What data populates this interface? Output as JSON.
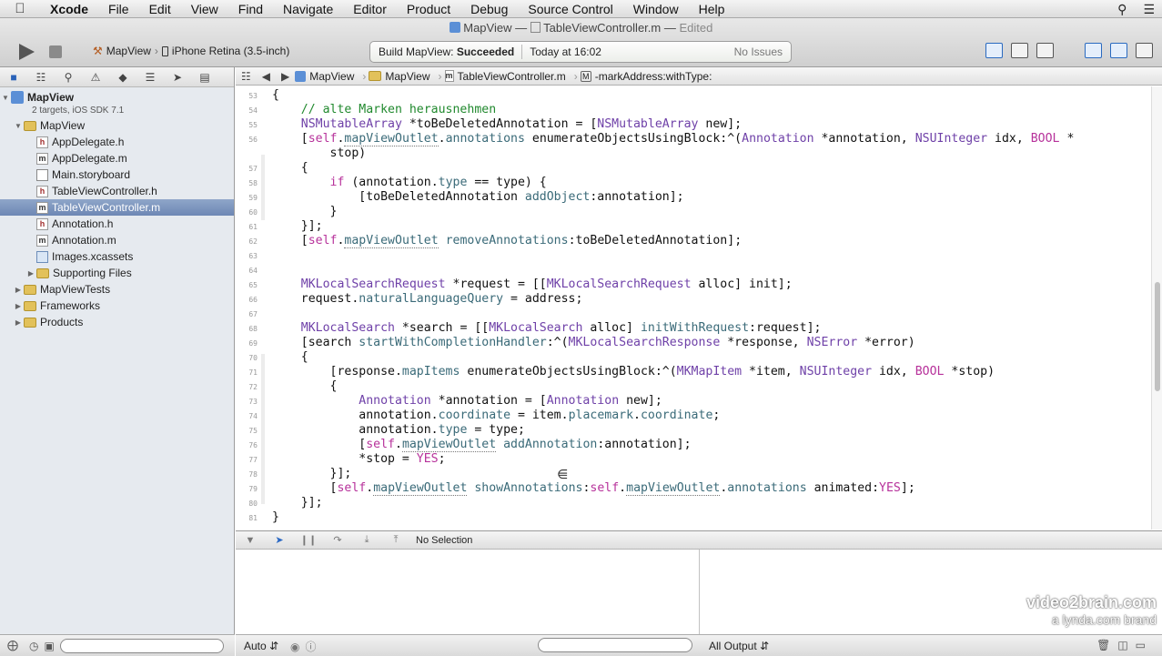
{
  "menubar": {
    "items": [
      "Xcode",
      "File",
      "Edit",
      "View",
      "Find",
      "Navigate",
      "Editor",
      "Product",
      "Debug",
      "Source Control",
      "Window",
      "Help"
    ]
  },
  "window": {
    "project": "MapView",
    "separator": "—",
    "file": "TableViewController.m",
    "edited": "Edited"
  },
  "toolbar": {
    "scheme": "MapView",
    "destination": "iPhone Retina (3.5-inch)",
    "status_prefix": "Build MapView:",
    "status_result": "Succeeded",
    "status_time": "Today at 16:02",
    "issues": "No Issues"
  },
  "navigator": {
    "project_name": "MapView",
    "project_sub": "2 targets, iOS SDK 7.1",
    "items": [
      {
        "label": "MapView",
        "type": "folder",
        "indent": 1,
        "disclosure": "open"
      },
      {
        "label": "AppDelegate.h",
        "type": "h",
        "indent": 2
      },
      {
        "label": "AppDelegate.m",
        "type": "m",
        "indent": 2
      },
      {
        "label": "Main.storyboard",
        "type": "sb",
        "indent": 2
      },
      {
        "label": "TableViewController.h",
        "type": "h",
        "indent": 2
      },
      {
        "label": "TableViewController.m",
        "type": "m",
        "indent": 2,
        "selected": true
      },
      {
        "label": "Annotation.h",
        "type": "h",
        "indent": 2
      },
      {
        "label": "Annotation.m",
        "type": "m",
        "indent": 2
      },
      {
        "label": "Images.xcassets",
        "type": "assets",
        "indent": 2
      },
      {
        "label": "Supporting Files",
        "type": "folder",
        "indent": 2,
        "disclosure": "closed"
      },
      {
        "label": "MapViewTests",
        "type": "folder",
        "indent": 1,
        "disclosure": "closed"
      },
      {
        "label": "Frameworks",
        "type": "folder",
        "indent": 1,
        "disclosure": "closed"
      },
      {
        "label": "Products",
        "type": "folder",
        "indent": 1,
        "disclosure": "closed"
      }
    ]
  },
  "jumpbar": {
    "crumbs": [
      "MapView",
      "MapView",
      "TableViewController.m",
      "-markAddress:withType:"
    ]
  },
  "editor": {
    "lines": [
      {
        "n": "53",
        "html": "{"
      },
      {
        "n": "54",
        "html": "    <span class='cm'>// alte Marken herausnehmen</span>"
      },
      {
        "n": "55",
        "html": "    <span class='ty'>NSMutableArray</span> *toBeDeletedAnnotation = [<span class='ty'>NSMutableArray</span> new];"
      },
      {
        "n": "56",
        "html": "    [<span class='kw'>self</span>.<span class='ul'>mapViewOutlet</span>.<span class='mt'>annotations</span> enumerateObjectsUsingBlock:^(<span class='ty'>Annotation</span> *annotation, <span class='ty'>NSUInteger</span> idx, <span class='kw'>BOOL</span> *"
      },
      {
        "n": "",
        "html": "        stop)"
      },
      {
        "n": "57",
        "html": "    {"
      },
      {
        "n": "58",
        "html": "        <span class='kw'>if</span> (annotation.<span class='mt'>type</span> == type) {"
      },
      {
        "n": "59",
        "html": "            [toBeDeletedAnnotation <span class='mt'>addObject</span>:annotation];"
      },
      {
        "n": "60",
        "html": "        }"
      },
      {
        "n": "61",
        "html": "    }];"
      },
      {
        "n": "62",
        "html": "    [<span class='kw'>self</span>.<span class='ul'>mapViewOutlet</span> <span class='mt'>removeAnnotations</span>:toBeDeletedAnnotation];"
      },
      {
        "n": "63",
        "html": ""
      },
      {
        "n": "64",
        "html": ""
      },
      {
        "n": "65",
        "html": "    <span class='ty'>MKLocalSearchRequest</span> *request = [[<span class='ty'>MKLocalSearchRequest</span> alloc] init];"
      },
      {
        "n": "66",
        "html": "    request.<span class='mt'>naturalLanguageQuery</span> = address;"
      },
      {
        "n": "67",
        "html": ""
      },
      {
        "n": "68",
        "html": "    <span class='ty'>MKLocalSearch</span> *search = [[<span class='ty'>MKLocalSearch</span> alloc] <span class='mt'>initWithRequest</span>:request];"
      },
      {
        "n": "69",
        "html": "    [search <span class='mt'>startWithCompletionHandler</span>:^(<span class='ty'>MKLocalSearchResponse</span> *response, <span class='ty'>NSError</span> *error)"
      },
      {
        "n": "70",
        "html": "    {"
      },
      {
        "n": "71",
        "html": "        [response.<span class='mt'>mapItems</span> enumerateObjectsUsingBlock:^(<span class='ty'>MKMapItem</span> *item, <span class='ty'>NSUInteger</span> idx, <span class='kw'>BOOL</span> *stop)"
      },
      {
        "n": "72",
        "html": "        {"
      },
      {
        "n": "73",
        "html": "            <span class='ty'>Annotation</span> *annotation = [<span class='ty'>Annotation</span> new];"
      },
      {
        "n": "74",
        "html": "            annotation.<span class='mt'>coordinate</span> = item.<span class='mt'>placemark</span>.<span class='mt'>coordinate</span>;"
      },
      {
        "n": "75",
        "html": "            annotation.<span class='mt'>type</span> = type;"
      },
      {
        "n": "76",
        "html": "            [<span class='kw'>self</span>.<span class='ul'>mapViewOutlet</span> <span class='mt'>addAnnotation</span>:annotation];"
      },
      {
        "n": "77",
        "html": "            *stop = <span class='kw'>YES</span>;"
      },
      {
        "n": "78",
        "html": "        }];"
      },
      {
        "n": "79",
        "html": "        [<span class='kw'>self</span>.<span class='ul'>mapViewOutlet</span> <span class='mt'>showAnnotations</span>:<span class='kw'>self</span>.<span class='ul'>mapViewOutlet</span>.<span class='mt'>annotations</span> animated:<span class='kw'>YES</span>];"
      },
      {
        "n": "80",
        "html": "    }];"
      },
      {
        "n": "81",
        "html": "}"
      }
    ]
  },
  "debug": {
    "selection": "No Selection",
    "auto_label": "Auto",
    "output_label": "All Output"
  },
  "watermark": {
    "line1": "video2brain.com",
    "line2": "a lynda.com brand"
  }
}
